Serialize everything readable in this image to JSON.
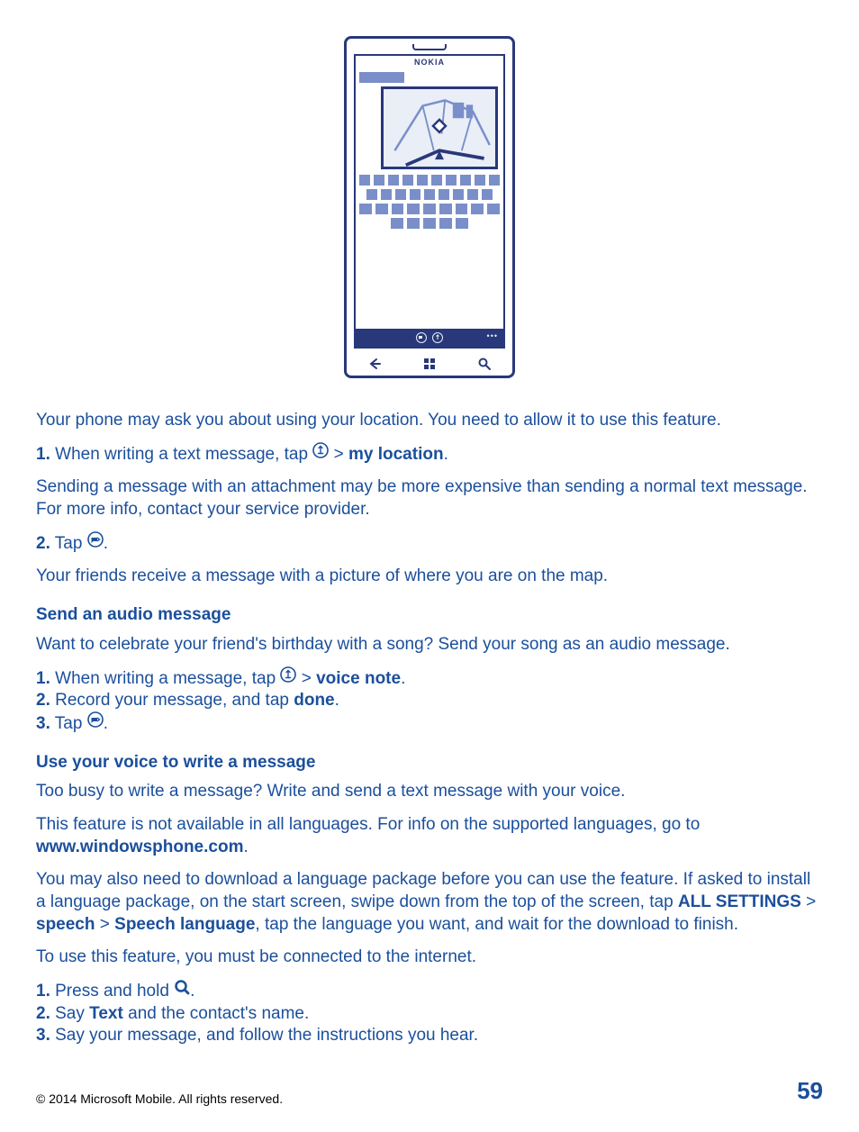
{
  "phone": {
    "brand": "NOKIA"
  },
  "intro": {
    "p1": "Your phone may ask you about using your location. You need to allow it to use this feature.",
    "step1_num": "1.",
    "step1_a": " When writing a text message, tap ",
    "step1_b": " > ",
    "step1_c": "my location",
    "step1_d": ".",
    "p2": "Sending a message with an attachment may be more expensive than sending a normal text message. For more info, contact your service provider.",
    "step2_num": "2.",
    "step2_a": " Tap ",
    "step2_b": ".",
    "p3": "Your friends receive a message with a picture of where you are on the map."
  },
  "audio": {
    "head": "Send an audio message",
    "p1": "Want to celebrate your friend's birthday with a song? Send your song as an audio message.",
    "s1_num": "1.",
    "s1_a": " When writing a message, tap ",
    "s1_b": " > ",
    "s1_c": "voice note",
    "s1_d": ".",
    "s2_num": "2.",
    "s2_a": " Record your message, and tap ",
    "s2_b": "done",
    "s2_c": ".",
    "s3_num": "3.",
    "s3_a": " Tap ",
    "s3_b": "."
  },
  "voice": {
    "head": "Use your voice to write a message",
    "p1": "Too busy to write a message? Write and send a text message with your voice.",
    "p2a": "This feature is not available in all languages. For info on the supported languages, go to ",
    "p2b": "www.windowsphone.com",
    "p2c": ".",
    "p3a": "You may also need to download a language package before you can use the feature. If asked to install a language package, on the start screen, swipe down from the top of the screen, tap ",
    "p3b": "ALL SETTINGS",
    "p3c": " > ",
    "p3d": "speech",
    "p3e": " > ",
    "p3f": "Speech language",
    "p3g": ", tap the language you want, and wait for the download to finish.",
    "p4": "To use this feature, you must be connected to the internet.",
    "s1_num": "1.",
    "s1_a": " Press and hold ",
    "s1_b": ".",
    "s2_num": "2.",
    "s2_a": " Say ",
    "s2_b": "Text",
    "s2_c": " and the contact's name.",
    "s3_num": "3.",
    "s3_a": " Say your message, and follow the instructions you hear."
  },
  "footer": {
    "copyright": "© 2014 Microsoft Mobile. All rights reserved.",
    "page": "59"
  }
}
